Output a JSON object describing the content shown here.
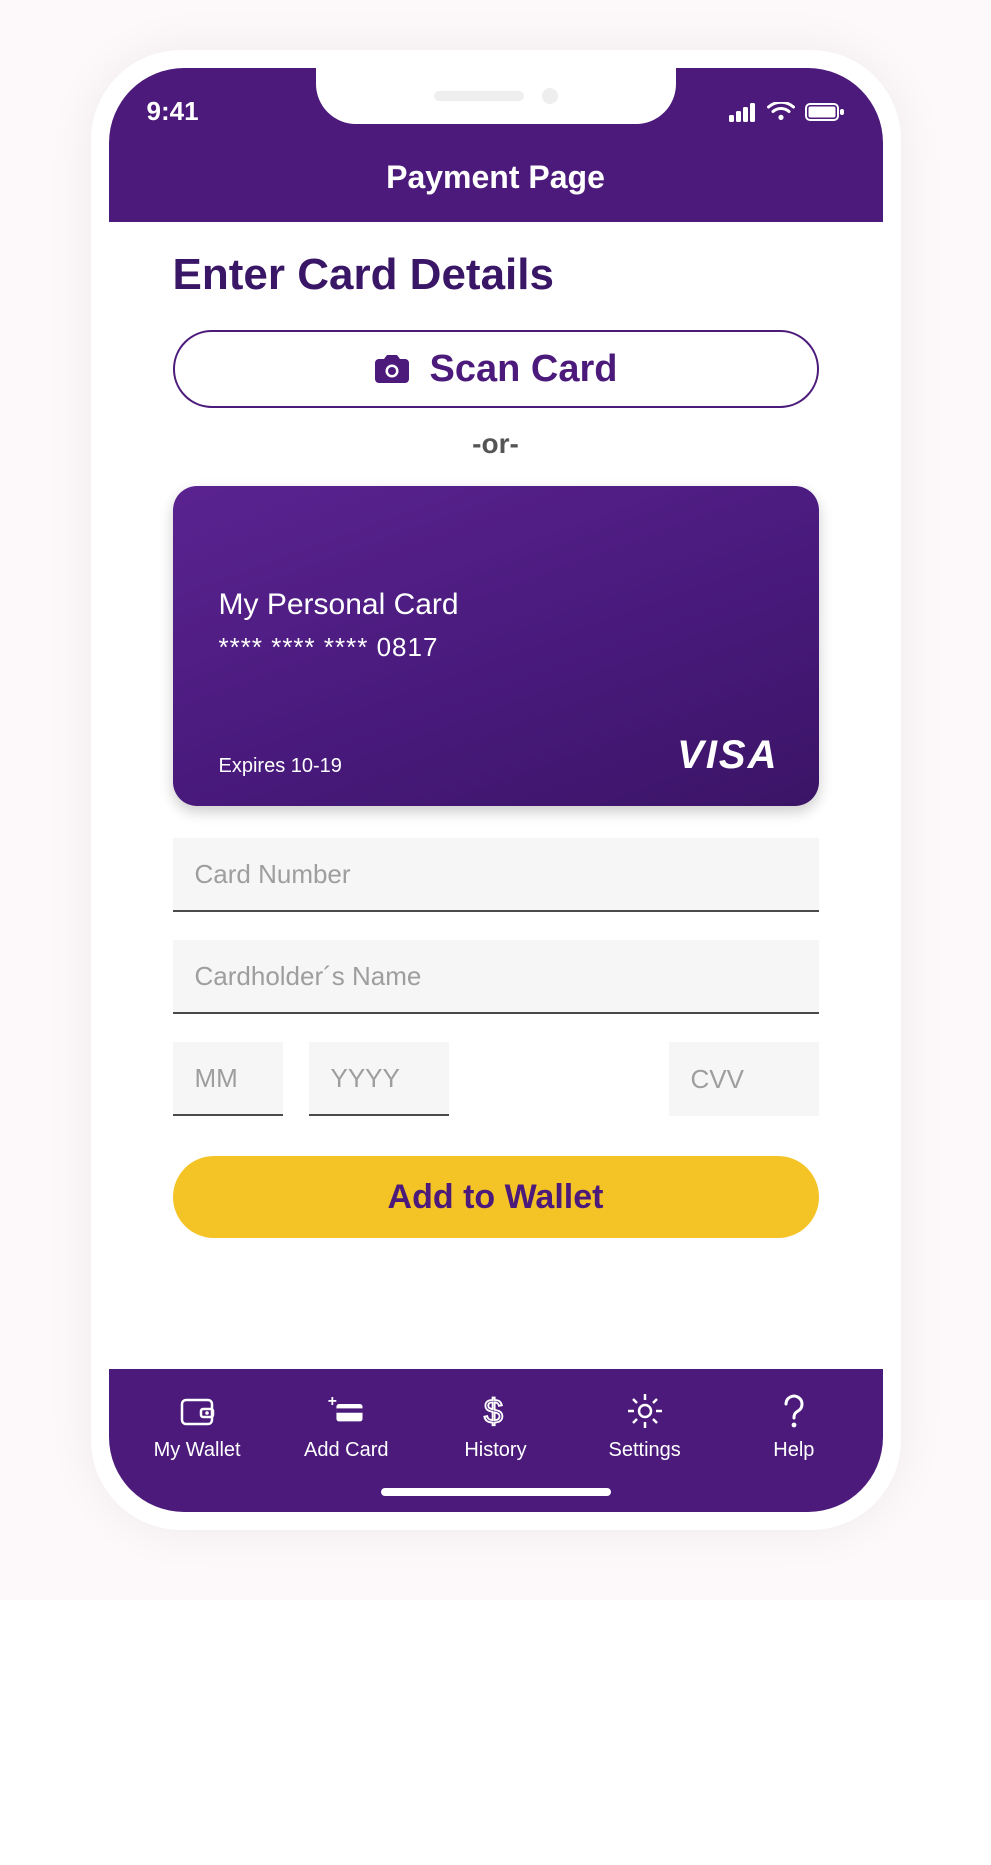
{
  "status": {
    "time": "9:41"
  },
  "header": {
    "title": "Payment Page"
  },
  "page": {
    "heading": "Enter Card Details",
    "scan_label": "Scan Card",
    "or_label": "-or-"
  },
  "card": {
    "name": "My Personal Card",
    "masked_number": "****  ****  ****    0817",
    "expires_label": "Expires 10-19",
    "brand": "VISA"
  },
  "inputs": {
    "card_number": {
      "placeholder": "Card Number",
      "value": ""
    },
    "cardholder": {
      "placeholder": "Cardholder´s Name",
      "value": ""
    },
    "month": {
      "placeholder": "MM",
      "value": ""
    },
    "year": {
      "placeholder": "YYYY",
      "value": ""
    },
    "cvv": {
      "placeholder": "CVV",
      "value": ""
    }
  },
  "actions": {
    "add_label": "Add to Wallet"
  },
  "tabs": {
    "wallet": "My Wallet",
    "add": "Add Card",
    "history": "History",
    "settings": "Settings",
    "help": "Help"
  }
}
